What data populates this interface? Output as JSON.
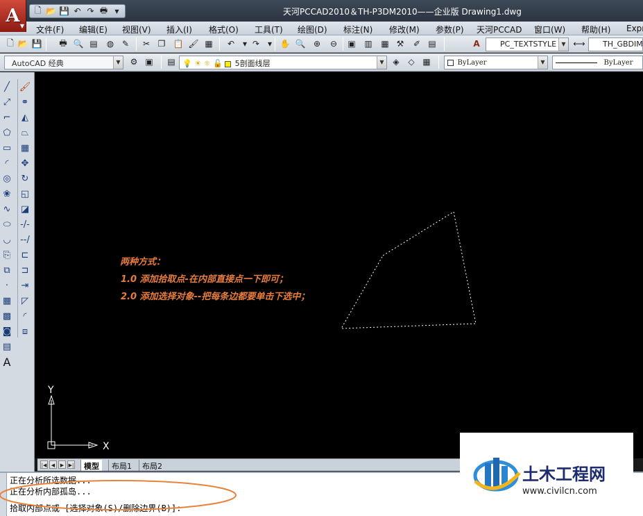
{
  "app": {
    "title": "天河PCCAD2010＆TH-P3DM2010——企业版   Drawing1.dwg"
  },
  "quick_access": {
    "icons": [
      "new-icon",
      "open-icon",
      "save-icon",
      "undo-icon",
      "redo-icon",
      "plot-icon"
    ]
  },
  "menu": {
    "items": [
      "文件(F)",
      "编辑(E)",
      "视图(V)",
      "插入(I)",
      "格式(O)",
      "工具(T)",
      "绘图(D)",
      "标注(N)",
      "修改(M)",
      "参数(P)",
      "天河PCCAD",
      "窗口(W)",
      "帮助(H)",
      "Expr"
    ]
  },
  "toolbar": {
    "text_style": "PC_TEXTSTYLE",
    "dim_style": "TH_GBDIM",
    "workspace": "AutoCAD 经典",
    "layer": "5剖面线层",
    "color": "ByLayer",
    "linetype": "ByLayer"
  },
  "annotation": {
    "heading": "两种方式：",
    "line1": "1.0  添加拾取点-在内部直接点一下即可；",
    "line2": "2.0  添加选择对象--把每条边都要单击下选中；"
  },
  "ucs": {
    "x_label": "X",
    "y_label": "Y"
  },
  "layout_tabs": {
    "tabs": [
      "模型",
      "布局1",
      "布局2"
    ],
    "active": "模型"
  },
  "command_line": {
    "line1": "正在分析所选数据...",
    "line2": "正在分析内部孤岛...",
    "prompt": "拾取内部点或 [选择对象(S)/删除边界(B)]:"
  },
  "watermark": {
    "brand": "土木工程网",
    "url": "www.civilcn.com"
  },
  "colors": {
    "annotation": "#ea7d3a",
    "highlight_ellipse": "#e8823a",
    "canvas": "#000000"
  }
}
